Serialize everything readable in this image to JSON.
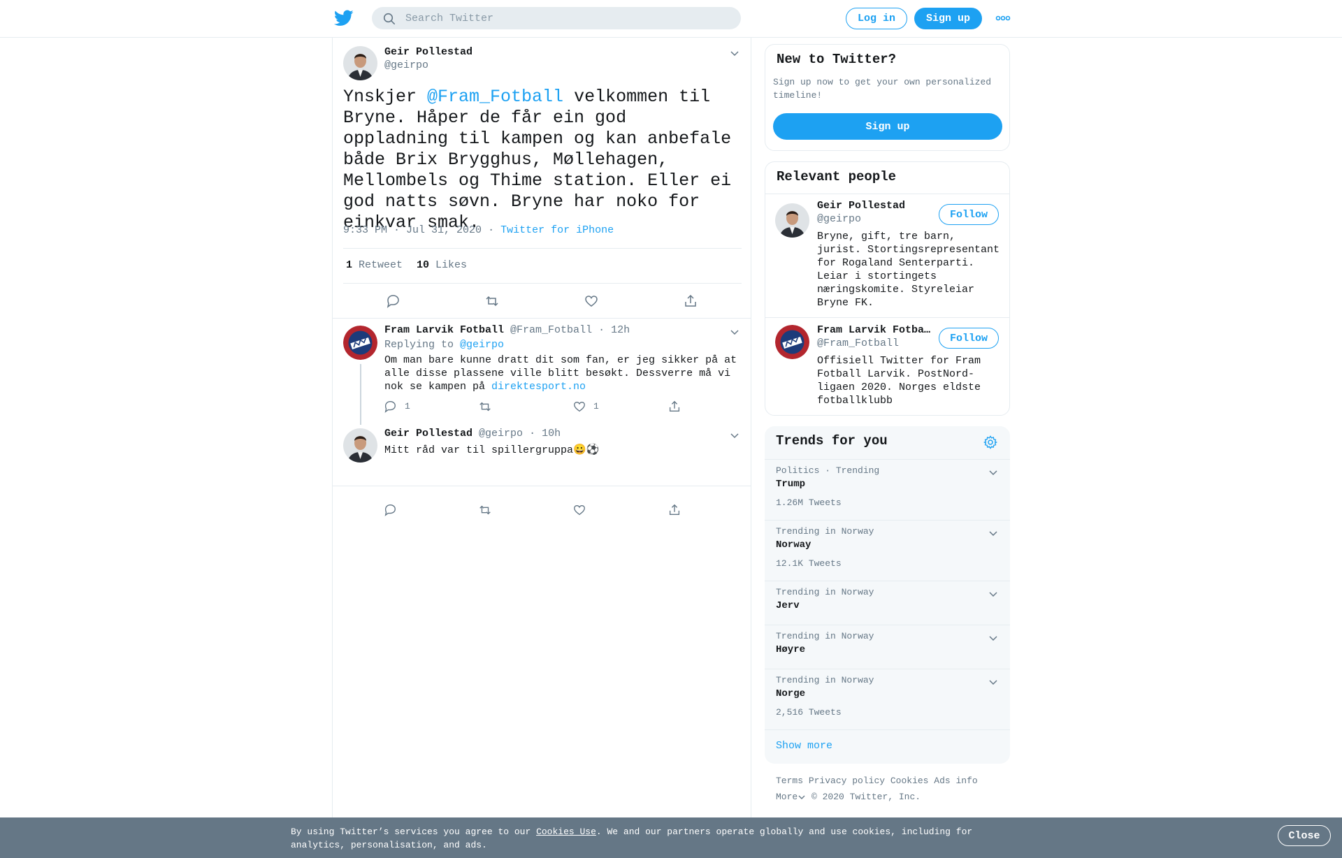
{
  "colors": {
    "accent": "#1da1f2",
    "muted": "#657786",
    "cookie_bar": "#657786"
  },
  "header": {
    "search_placeholder": "Search Twitter",
    "login_label": "Log in",
    "signup_label": "Sign up"
  },
  "tweet": {
    "author_name": "Geir Pollestad",
    "author_handle": "@geirpo",
    "text_before": "Ynskjer ",
    "mention": "@Fram_Fotball",
    "text_after": " velkommen til Bryne. Håper de får ein god oppladning til kampen og kan anbefale både Brix Brygghus, Møllehagen, Mellombels og Thime station. Eller ei god natts søvn. Bryne har noko for einkvar smak.",
    "time": "9:33 PM · Jul 31, 2020",
    "dot": "·",
    "source": "Twitter for iPhone",
    "retweet_count": "1",
    "retweet_label": "Retweet",
    "like_count": "10",
    "like_label": "Likes"
  },
  "replies": [
    {
      "name": "Fram Larvik Fotball",
      "handle": "@Fram_Fotball",
      "time": "· 12h",
      "replying_label": "Replying to",
      "replying_to": "@geirpo",
      "text": "Om man bare kunne dratt dit som fan, er jeg sikker på at alle disse plassene ville blitt besøkt. Dessverre må vi nok se kampen på ",
      "link": "direktesport.no",
      "reply_count": "1",
      "like_count": "1"
    },
    {
      "name": "Geir Pollestad",
      "handle": "@geirpo",
      "time": "· 10h",
      "text": "Mitt råd var til spillergruppa😀⚽"
    }
  ],
  "new_to_twitter": {
    "title": "New to Twitter?",
    "subtitle": "Sign up now to get your own personalized timeline!",
    "signup_label": "Sign up"
  },
  "relevant_people": {
    "title": "Relevant people",
    "follow_label": "Follow",
    "people": [
      {
        "name": "Geir Pollestad",
        "handle": "@geirpo",
        "bio": "Bryne, gift, tre barn, jurist. Stortingsrepresentant for Rogaland Senterparti. Leiar i stortingets næringskomite. Styreleiar Bryne FK."
      },
      {
        "name": "Fram Larvik Fotba…",
        "handle": "@Fram_Fotball",
        "bio": "Offisiell Twitter for Fram Fotball Larvik. PostNord-ligaen 2020. Norges eldste fotballklubb"
      }
    ]
  },
  "trends": {
    "title": "Trends for you",
    "items": [
      {
        "context": "Politics · Trending",
        "name": "Trump",
        "count": "1.26M Tweets"
      },
      {
        "context": "Trending in Norway",
        "name": "Norway",
        "count": "12.1K Tweets"
      },
      {
        "context": "Trending in Norway",
        "name": "Jerv",
        "count": ""
      },
      {
        "context": "Trending in Norway",
        "name": "Høyre",
        "count": ""
      },
      {
        "context": "Trending in Norway",
        "name": "Norge",
        "count": "2,516 Tweets"
      }
    ],
    "show_more": "Show more"
  },
  "footer": {
    "terms": "Terms",
    "privacy": "Privacy policy",
    "cookies": "Cookies",
    "ads": "Ads info",
    "more": "More",
    "copyright": "© 2020 Twitter, Inc."
  },
  "cookie_bar": {
    "text_before": "By using Twitter’s services you agree to our ",
    "link": "Cookies Use",
    "text_after": ". We and our partners operate globally and use cookies, including for analytics, personalisation, and ads.",
    "close_label": "Close"
  }
}
